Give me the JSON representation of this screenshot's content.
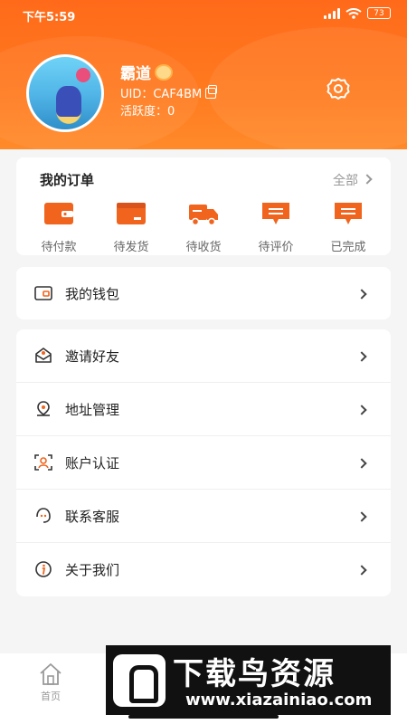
{
  "status_bar": {
    "time": "下午5:59",
    "battery": "73"
  },
  "profile": {
    "username": "霸道",
    "uid": "UID：CAF4BM",
    "activity": "活跃度：0"
  },
  "orders": {
    "title": "我的订单",
    "all_label": "全部",
    "items": [
      {
        "label": "待付款",
        "icon": "wallet-icon"
      },
      {
        "label": "待发货",
        "icon": "box-icon"
      },
      {
        "label": "待收货",
        "icon": "truck-icon"
      },
      {
        "label": "待评价",
        "icon": "comment-icon"
      },
      {
        "label": "已完成",
        "icon": "message-done-icon"
      }
    ]
  },
  "menu": {
    "wallet": "我的钱包",
    "invite": "邀请好友",
    "address": "地址管理",
    "verify": "账户认证",
    "service": "联系客服",
    "about": "关于我们"
  },
  "tabbar": {
    "home": "首页"
  },
  "watermark": {
    "title": "下载鸟资源",
    "url": "www.xiazainiao.com"
  },
  "colors": {
    "accent": "#ff6a1a",
    "icon_orange": "#f0641e"
  }
}
